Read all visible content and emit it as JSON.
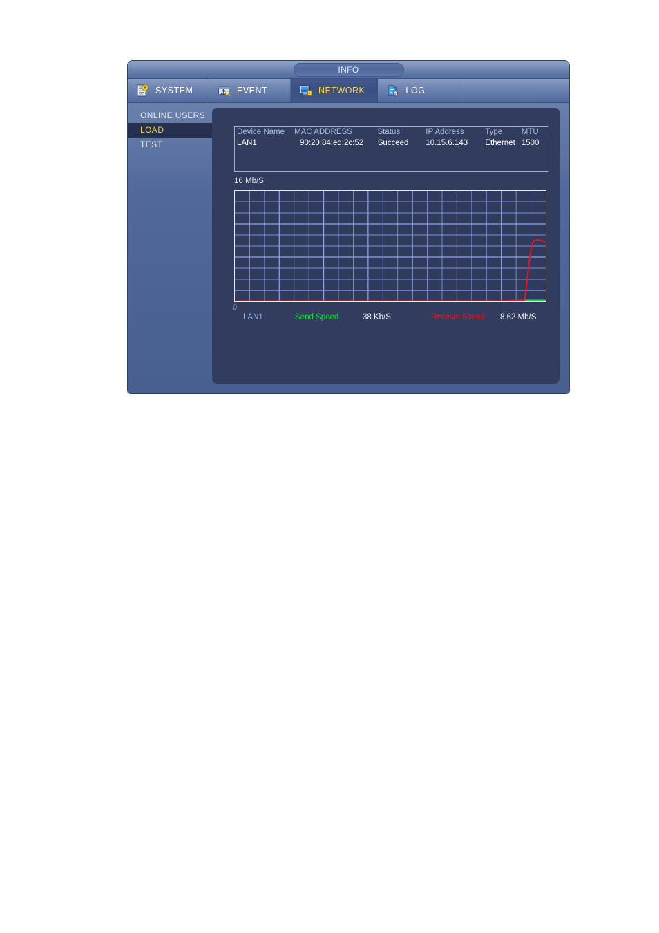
{
  "window": {
    "title": "INFO"
  },
  "tabs": [
    {
      "label": "SYSTEM",
      "icon": "system-document-gear-icon",
      "active": false
    },
    {
      "label": "EVENT",
      "icon": "event-warning-search-icon",
      "active": false
    },
    {
      "label": "NETWORK",
      "icon": "network-monitor-icon",
      "active": true
    },
    {
      "label": "LOG",
      "icon": "log-clipboard-icon",
      "active": false
    }
  ],
  "sidebar": {
    "items": [
      {
        "label": "ONLINE USERS",
        "selected": false
      },
      {
        "label": "LOAD",
        "selected": true
      },
      {
        "label": "TEST",
        "selected": false
      }
    ]
  },
  "device_table": {
    "headers": [
      "Device Name",
      "MAC ADDRESS",
      "Status",
      "IP Address",
      "Type",
      "MTU"
    ],
    "rows": [
      {
        "device_name": "LAN1",
        "mac_address": "90:20:84:ed:2c:52",
        "status": "Succeed",
        "ip_address": "10.15.6.143",
        "type": "Ethernet",
        "mtu": "1500"
      }
    ]
  },
  "chart_data": {
    "type": "line",
    "title": "",
    "xlabel": "",
    "ylabel": "",
    "y_top_label": "16 Mb/S",
    "y_bottom_label": "0",
    "ylim": [
      0,
      16
    ],
    "grid": true,
    "grid_columns": 21,
    "grid_rows": 10,
    "series": [
      {
        "name": "Send Speed",
        "color": "#00e52b",
        "value_label": "38 Kb/S",
        "value_mbps": 0.038,
        "points": [
          [
            0,
            0
          ],
          [
            60,
            0
          ],
          [
            70,
            0
          ],
          [
            80,
            0
          ],
          [
            86,
            0
          ],
          [
            90,
            0.12
          ],
          [
            94,
            0.14
          ],
          [
            98,
            0.14
          ],
          [
            100,
            0.14
          ]
        ]
      },
      {
        "name": "Receive Speed",
        "color": "#f41414",
        "value_label": "8.62 Mb/S",
        "value_mbps": 8.62,
        "points": [
          [
            0,
            0.05
          ],
          [
            55,
            0.05
          ],
          [
            70,
            0.05
          ],
          [
            80,
            0.05
          ],
          [
            85,
            0.05
          ],
          [
            93.2,
            0.2
          ],
          [
            93.6,
            1.4
          ],
          [
            94.0,
            3.0
          ],
          [
            94.4,
            4.6
          ],
          [
            94.8,
            6.0
          ],
          [
            95.2,
            7.3
          ],
          [
            95.6,
            8.2
          ],
          [
            96.2,
            8.8
          ],
          [
            97.0,
            8.9
          ],
          [
            98.2,
            8.85
          ],
          [
            99.4,
            8.7
          ],
          [
            100,
            8.65
          ]
        ]
      }
    ],
    "legend": {
      "position": "bottom",
      "interface_name": "LAN1",
      "entries": [
        {
          "label": "Send Speed",
          "value": "38 Kb/S",
          "color": "#00e52b"
        },
        {
          "label": "Receive Speed",
          "value": "8.62 Mb/S",
          "color": "#f41414"
        }
      ]
    }
  },
  "colors": {
    "window_bg": "#4d6596",
    "panel_bg": "#323c5e",
    "accent_yellow": "#ffd21e",
    "chart_grid": "#8a9fe0",
    "chart_border": "#e8ecf5",
    "send_color": "#00e52b",
    "receive_color": "#f41414"
  }
}
